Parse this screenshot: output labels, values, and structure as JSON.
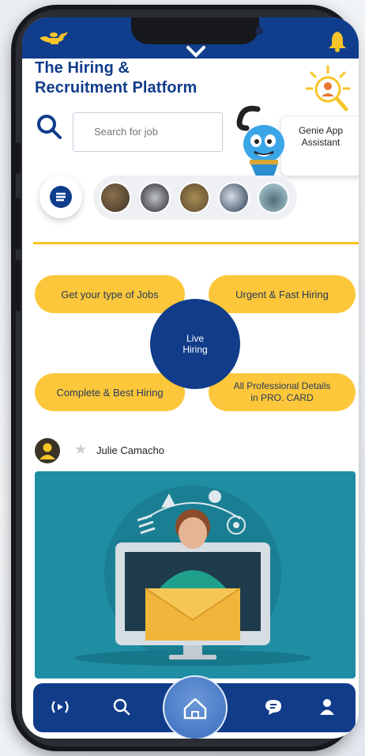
{
  "app": {
    "title_line1": "The Hiring &",
    "title_line2": "Recruitment Platform"
  },
  "search": {
    "placeholder": "Search for job"
  },
  "assistant": {
    "label_line1": "Genie App",
    "label_line2": "Assistant"
  },
  "menu": {
    "icon": "menu-lines-icon"
  },
  "stories": {
    "count": 5
  },
  "features": {
    "jobs_type": "Get your type of Jobs",
    "urgent": "Urgent & Fast Hiring",
    "live_line1": "Live",
    "live_line2": "Hiring",
    "complete": "Complete & Best Hiring",
    "pro_line1": "All Professional Details",
    "pro_line2": "in PRO. CARD"
  },
  "post": {
    "author": "Julie Camacho",
    "star_icon": "star-icon"
  },
  "bottom_nav": {
    "items": [
      "broadcast-icon",
      "search-icon",
      "home-icon",
      "chat-icon",
      "profile-icon"
    ],
    "active": "home-icon"
  },
  "colors": {
    "brand_blue": "#113c8a",
    "accent_yellow": "#fcc73a",
    "divider_yellow": "#f5c41c",
    "post_teal": "#1f8ea3"
  }
}
